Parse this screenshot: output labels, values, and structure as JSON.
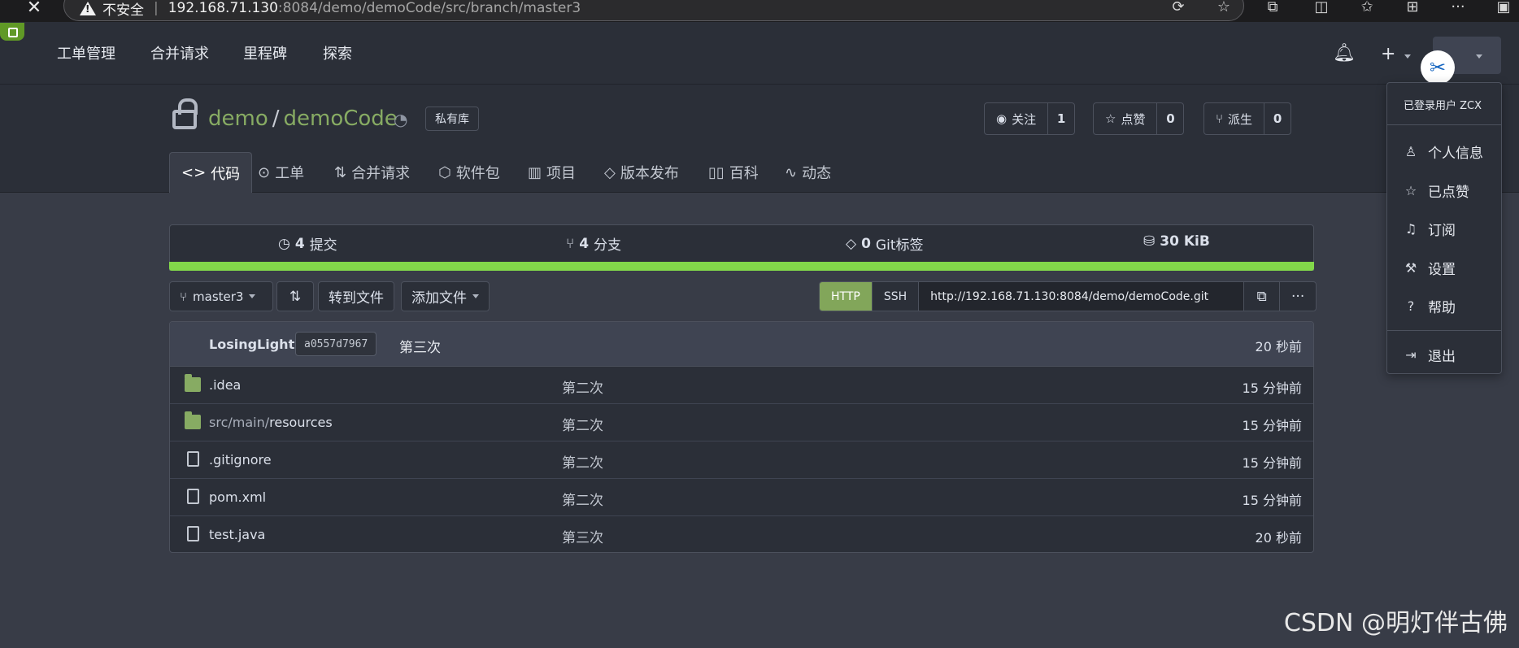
{
  "browser": {
    "security_label": "不安全",
    "url_host": "192.168.71.130",
    "url_rest": ":8084/demo/demoCode/src/branch/master3"
  },
  "nav": {
    "items": [
      "工单管理",
      "合并请求",
      "里程碑",
      "探索"
    ]
  },
  "repo": {
    "owner": "demo",
    "name": "demoCode",
    "visibility": "私有库",
    "watch": {
      "label": "关注",
      "count": "1"
    },
    "star": {
      "label": "点赞",
      "count": "0"
    },
    "fork": {
      "label": "派生",
      "count": "0"
    }
  },
  "tabs": [
    "代码",
    "工单",
    "合并请求",
    "软件包",
    "项目",
    "版本发布",
    "百科",
    "动态"
  ],
  "stats": {
    "commits": {
      "num": "4",
      "label": "提交"
    },
    "branches": {
      "num": "4",
      "label": "分支"
    },
    "tags": {
      "num": "0",
      "label": "Git标签"
    },
    "size": "30 KiB"
  },
  "toolbar": {
    "branch": "master3",
    "goto_file": "转到文件",
    "add_file": "添加文件",
    "clone_http": "HTTP",
    "clone_ssh": "SSH",
    "clone_url": "http://192.168.71.130:8084/demo/demoCode.git"
  },
  "latest_commit": {
    "author": "LosingLight",
    "sha": "a0557d7967",
    "message": "第三次",
    "time": "20 秒前"
  },
  "files": [
    {
      "type": "folder",
      "prefix": "",
      "name": ".idea",
      "message": "第二次",
      "time": "15 分钟前"
    },
    {
      "type": "folder",
      "prefix": "src/main/",
      "name": "resources",
      "message": "第二次",
      "time": "15 分钟前"
    },
    {
      "type": "file",
      "prefix": "",
      "name": ".gitignore",
      "message": "第二次",
      "time": "15 分钟前"
    },
    {
      "type": "file",
      "prefix": "",
      "name": "pom.xml",
      "message": "第二次",
      "time": "15 分钟前"
    },
    {
      "type": "file",
      "prefix": "",
      "name": "test.java",
      "message": "第三次",
      "time": "20 秒前"
    }
  ],
  "user_menu": {
    "header": "已登录用户 ZCX",
    "items": [
      "个人信息",
      "已点赞",
      "订阅",
      "设置",
      "帮助"
    ],
    "logout": "退出"
  },
  "watermark": "CSDN @明灯伴古佛",
  "colors": {
    "accent_green": "#87ab63",
    "lang_bar": "#82d84a",
    "background": "#383c47",
    "header_bg": "#2b2f38"
  }
}
